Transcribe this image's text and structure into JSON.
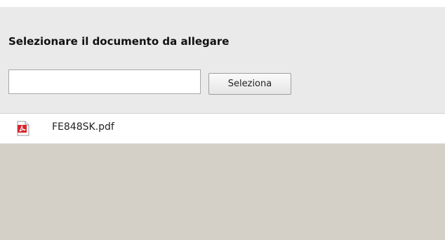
{
  "upload_panel": {
    "title": "Selezionare il documento da allegare",
    "file_input": {
      "value": "",
      "placeholder": ""
    },
    "select_button_label": "Seleziona"
  },
  "attachments": [
    {
      "icon": "pdf-file-icon",
      "name": "FE848SK.pdf"
    }
  ],
  "colors": {
    "panel_background": "#eaeaea",
    "page_background": "#d4d0c8",
    "pdf_icon_red": "#d9262c"
  }
}
